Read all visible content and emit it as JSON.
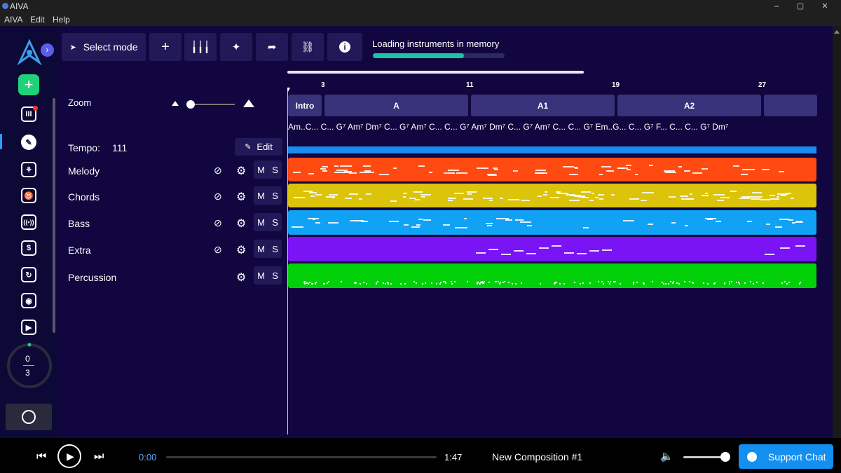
{
  "window": {
    "title": "AIVA",
    "minimize": "–",
    "restore": "▢",
    "close": "✕"
  },
  "menu": [
    "AIVA",
    "Edit",
    "Help"
  ],
  "sidebar": {
    "timer_top": "0",
    "timer_bottom": "3",
    "icons": [
      "new-composition-icon",
      "library-icon",
      "edit-icon",
      "style-icon",
      "preset-icon",
      "radio-icon",
      "pricing-icon",
      "history-icon",
      "discord-icon",
      "tutorial-icon",
      "account-icon"
    ]
  },
  "toolbar": {
    "select_mode": "Select mode",
    "add": "+",
    "status": "Loading instruments in memory",
    "progress": 0.69
  },
  "left_panel": {
    "zoom": "Zoom",
    "tempo_label": "Tempo:",
    "tempo_value": "111",
    "edit": "Edit"
  },
  "tracks": [
    {
      "name": "Melody",
      "color": "#ff4a12",
      "mute": "M",
      "solo": "S"
    },
    {
      "name": "Chords",
      "color": "#dcc40a",
      "mute": "M",
      "solo": "S"
    },
    {
      "name": "Bass",
      "color": "#11a2f5",
      "mute": "M",
      "solo": "S"
    },
    {
      "name": "Extra",
      "color": "#7a14f5",
      "mute": "M",
      "solo": "S"
    },
    {
      "name": "Percussion",
      "color": "#02d10a",
      "mute": "M",
      "solo": "S"
    }
  ],
  "timeline": {
    "bars": [
      "3",
      "11",
      "19",
      "27"
    ],
    "sections": [
      "Intro",
      "A",
      "A1",
      "A2"
    ],
    "chords": "Am..C... C... G⁷  Am⁷ Dm⁷ C... G⁷  Am⁷ C... C... G⁷  Am⁷ Dm⁷ C... G⁷  Am⁷ C... C... G⁷  Em..G... C... G⁷  F... C... C... G⁷  Dm⁷"
  },
  "player": {
    "current_time": "0:00",
    "total_time": "1:47",
    "composition": "New Composition #1",
    "support": "Support Chat"
  }
}
